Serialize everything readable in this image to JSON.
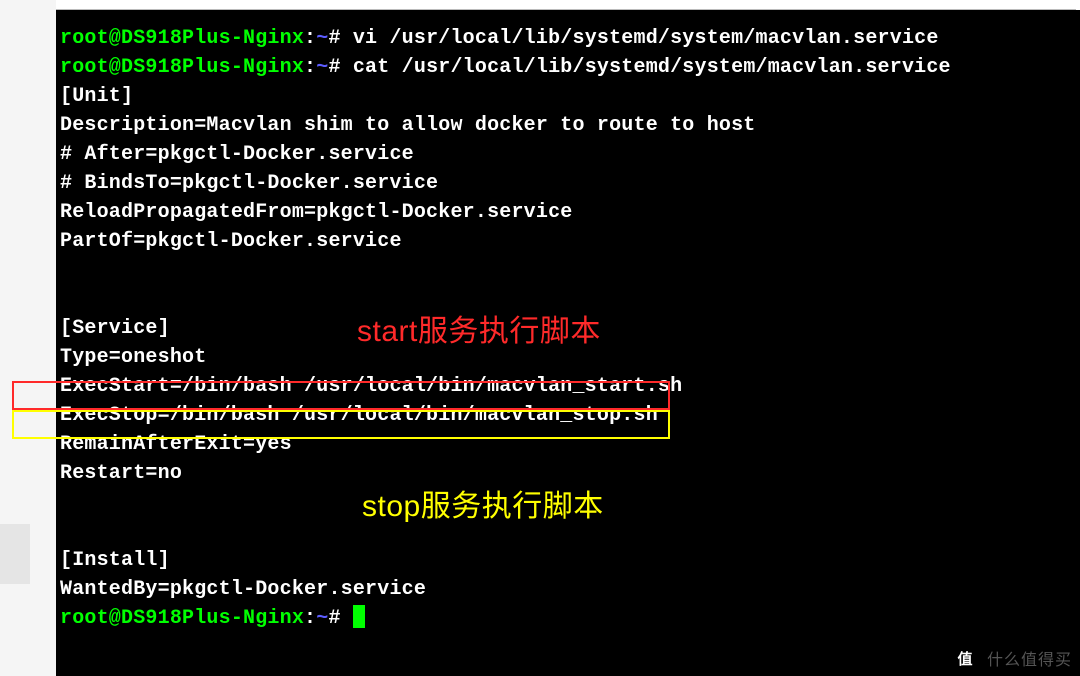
{
  "prompt": {
    "user_host": "root@DS918Plus-Nginx",
    "colon": ":",
    "cwd": "~",
    "hash": "#"
  },
  "cmd1": "vi /usr/local/lib/systemd/system/macvlan.service",
  "cmd2": "cat /usr/local/lib/systemd/system/macvlan.service",
  "file_lines": {
    "l0": "[Unit]",
    "l1": "Description=Macvlan shim to allow docker to route to host",
    "l2": "# After=pkgctl-Docker.service",
    "l3": "# BindsTo=pkgctl-Docker.service",
    "l4": "ReloadPropagatedFrom=pkgctl-Docker.service",
    "l5": "PartOf=pkgctl-Docker.service",
    "l6": "",
    "l7": "",
    "l8": "[Service]",
    "l9": "Type=oneshot",
    "l10": "ExecStart=/bin/bash /usr/local/bin/macvlan_start.sh",
    "l11": "ExecStop=/bin/bash /usr/local/bin/macvlan_stop.sh",
    "l12": "RemainAfterExit=yes",
    "l13": "Restart=no",
    "l14": "",
    "l15": "",
    "l16": "[Install]",
    "l17": "WantedBy=pkgctl-Docker.service"
  },
  "annotation_start": "start服务执行脚本",
  "annotation_stop": "stop服务执行脚本",
  "watermark": {
    "badge": "值",
    "text": "什么值得买"
  }
}
